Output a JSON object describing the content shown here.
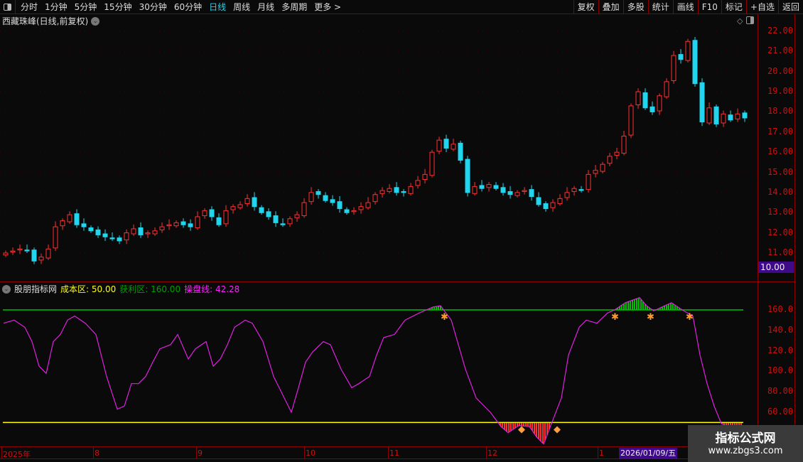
{
  "toolbar": {
    "periods": [
      "分时",
      "1分钟",
      "5分钟",
      "15分钟",
      "30分钟",
      "60分钟",
      "日线",
      "周线",
      "月线",
      "多周期",
      "更多 >"
    ],
    "active": "日线",
    "buttons": [
      "复权",
      "叠加",
      "多股",
      "统计",
      "画线",
      "F10",
      "标记",
      "+自选",
      "返回"
    ]
  },
  "main": {
    "title": "西藏珠峰(日线,前复权)",
    "current_price_label": "10.00",
    "price_ticks": [
      "22.00",
      "21.00",
      "20.00",
      "19.00",
      "18.00",
      "17.00",
      "16.00",
      "15.00",
      "14.00",
      "13.00",
      "12.00",
      "11.00"
    ]
  },
  "indicator": {
    "name": "股朋指标网",
    "cost_label": "成本区: 50.00",
    "profit_label": "获利区: 160.00",
    "line_label": "操盘线: 42.28",
    "ticks": [
      "160.0",
      "140.0",
      "120.0",
      "100.0",
      "80.00",
      "60.00"
    ]
  },
  "time_axis": {
    "labels": [
      "2025年",
      "8",
      "9",
      "10",
      "11",
      "12",
      "1"
    ],
    "cursor_date": "2026/01/09/五"
  },
  "watermark": {
    "title": "指标公式网",
    "url": "www.zbgs3.com"
  },
  "colors": {
    "up": "#ff3030",
    "down": "#22d5ee",
    "line": "#e020e0",
    "profit": "#00c000",
    "cost": "#ffff00",
    "grid": "#8b0000"
  },
  "chart_data": [
    {
      "type": "candlestick",
      "title": "西藏珠峰(日线,前复权)",
      "ylim": [
        10.5,
        22.3
      ],
      "closes": [
        11.0,
        11.1,
        11.2,
        11.1,
        10.6,
        10.8,
        11.2,
        12.3,
        12.6,
        12.9,
        12.4,
        12.3,
        12.1,
        11.9,
        11.8,
        11.7,
        11.6,
        12.0,
        12.2,
        11.9,
        12.0,
        12.1,
        12.3,
        12.4,
        12.5,
        12.4,
        12.3,
        12.8,
        13.1,
        12.8,
        12.4,
        13.1,
        13.3,
        13.4,
        13.7,
        13.3,
        13.0,
        12.8,
        12.5,
        12.4,
        12.7,
        12.9,
        13.5,
        14.0,
        13.9,
        13.6,
        13.5,
        13.2,
        13.0,
        13.1,
        13.3,
        13.5,
        13.9,
        14.1,
        14.2,
        14.0,
        14.0,
        14.3,
        14.6,
        14.9,
        16.0,
        16.6,
        16.2,
        16.4,
        15.6,
        14.0,
        14.3,
        14.2,
        14.4,
        14.2,
        14.0,
        13.9,
        14.0,
        14.1,
        13.8,
        13.4,
        13.2,
        13.5,
        13.7,
        14.0,
        14.2,
        14.1,
        14.9,
        15.1,
        15.4,
        15.8,
        16.0,
        16.8,
        18.3,
        19.0,
        18.2,
        18.0,
        18.8,
        19.5,
        20.8,
        20.6,
        21.5,
        19.4,
        17.5,
        18.2,
        17.4,
        17.9,
        17.6,
        17.9,
        17.7
      ]
    },
    {
      "type": "line",
      "title": "股朋指标网",
      "ylim": [
        25,
        175
      ],
      "profit_level": 160,
      "cost_level": 50,
      "points": [
        [
          0,
          147
        ],
        [
          3,
          150
        ],
        [
          6,
          143
        ],
        [
          8,
          129
        ],
        [
          10,
          105
        ],
        [
          12,
          98
        ],
        [
          14,
          129
        ],
        [
          16,
          136
        ],
        [
          18,
          150
        ],
        [
          20,
          154
        ],
        [
          23,
          147
        ],
        [
          26,
          136
        ],
        [
          29,
          95
        ],
        [
          32,
          63
        ],
        [
          34,
          66
        ],
        [
          36,
          88
        ],
        [
          38,
          88
        ],
        [
          40,
          95
        ],
        [
          42,
          109
        ],
        [
          44,
          122
        ],
        [
          47,
          126
        ],
        [
          49,
          136
        ],
        [
          52,
          112
        ],
        [
          54,
          122
        ],
        [
          57,
          129
        ],
        [
          59,
          105
        ],
        [
          61,
          112
        ],
        [
          63,
          126
        ],
        [
          65,
          143
        ],
        [
          68,
          150
        ],
        [
          70,
          147
        ],
        [
          73,
          129
        ],
        [
          76,
          95
        ],
        [
          79,
          74
        ],
        [
          81,
          60
        ],
        [
          83,
          84
        ],
        [
          85,
          109
        ],
        [
          87,
          119
        ],
        [
          90,
          129
        ],
        [
          92,
          126
        ],
        [
          95,
          102
        ],
        [
          98,
          84
        ],
        [
          100,
          88
        ],
        [
          103,
          95
        ],
        [
          105,
          116
        ],
        [
          107,
          133
        ],
        [
          110,
          136
        ],
        [
          113,
          150
        ],
        [
          117,
          157
        ],
        [
          121,
          163
        ],
        [
          123,
          164
        ],
        [
          126,
          150
        ],
        [
          130,
          102
        ],
        [
          133,
          74
        ],
        [
          137,
          60
        ],
        [
          140,
          46
        ],
        [
          142,
          40
        ],
        [
          145,
          47
        ],
        [
          148,
          46
        ],
        [
          150,
          36
        ],
        [
          152,
          29
        ],
        [
          154,
          47
        ],
        [
          157,
          74
        ],
        [
          159,
          116
        ],
        [
          162,
          143
        ],
        [
          164,
          150
        ],
        [
          167,
          147
        ],
        [
          170,
          157
        ],
        [
          172,
          160
        ],
        [
          175,
          167
        ],
        [
          179,
          172
        ],
        [
          181,
          164
        ],
        [
          183,
          159
        ],
        [
          186,
          164
        ],
        [
          188,
          167
        ],
        [
          191,
          160
        ],
        [
          194,
          154
        ],
        [
          196,
          116
        ],
        [
          198,
          88
        ],
        [
          200,
          66
        ],
        [
          202,
          49
        ],
        [
          204,
          46
        ],
        [
          208,
          46
        ]
      ],
      "buy_signals": [
        124,
        172,
        182,
        193
      ],
      "cost_signals": [
        146,
        156
      ]
    }
  ]
}
